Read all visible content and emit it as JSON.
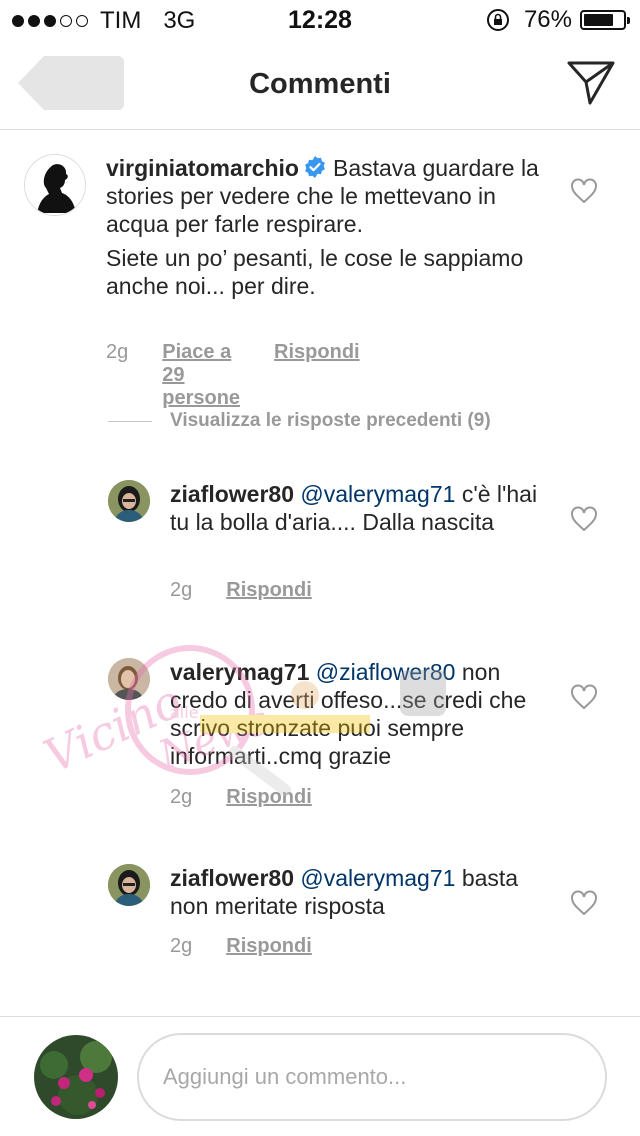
{
  "status_bar": {
    "signal_bars_filled": 3,
    "signal_bars_total": 5,
    "carrier": "TIM",
    "network": "3G",
    "time": "12:28",
    "battery_percent": "76%",
    "battery_level": 0.76
  },
  "nav": {
    "title": "Commenti",
    "back_icon": "back-arrow-icon",
    "send_icon": "direct-send-icon"
  },
  "main_comment": {
    "username": "virginiatomarchio",
    "verified": true,
    "line1": "Bastava guardare la stories per vedere che le mettevano in acqua per farle respirare.",
    "line2": "Siete un po’ pesanti, le cose le sappiamo anche noi... per dire.",
    "time": "2g",
    "likes": "Piace a 29 persone",
    "reply": "Rispondi"
  },
  "previous_replies": "Visualizza le risposte precedenti (9)",
  "replies": [
    {
      "username": "ziaflower80",
      "mention": "@valerymag71",
      "text": "c'è l'hai tu la bolla d'aria.... Dalla nascita",
      "time": "2g",
      "reply": "Rispondi"
    },
    {
      "username": "valerymag71",
      "mention": "@ziaflower80",
      "text": "non credo di averti offeso...se credi che scrivo stronzate puoi sempre informarti..cmq grazie",
      "time": "2g",
      "reply": "Rispondi"
    },
    {
      "username": "ziaflower80",
      "mention": "@valerymag71",
      "text": "basta non meritate risposta",
      "time": "2g",
      "reply": "Rispondi"
    }
  ],
  "composer": {
    "placeholder": "Aggiungi un commento..."
  },
  "watermark": {
    "text_a": "Vicino",
    "text_b": "alle",
    "text_c": "News"
  },
  "colors": {
    "text": "#262626",
    "meta": "#999999",
    "mention": "#003569",
    "verified": "#3897f0",
    "border": "#dbdbdb"
  }
}
